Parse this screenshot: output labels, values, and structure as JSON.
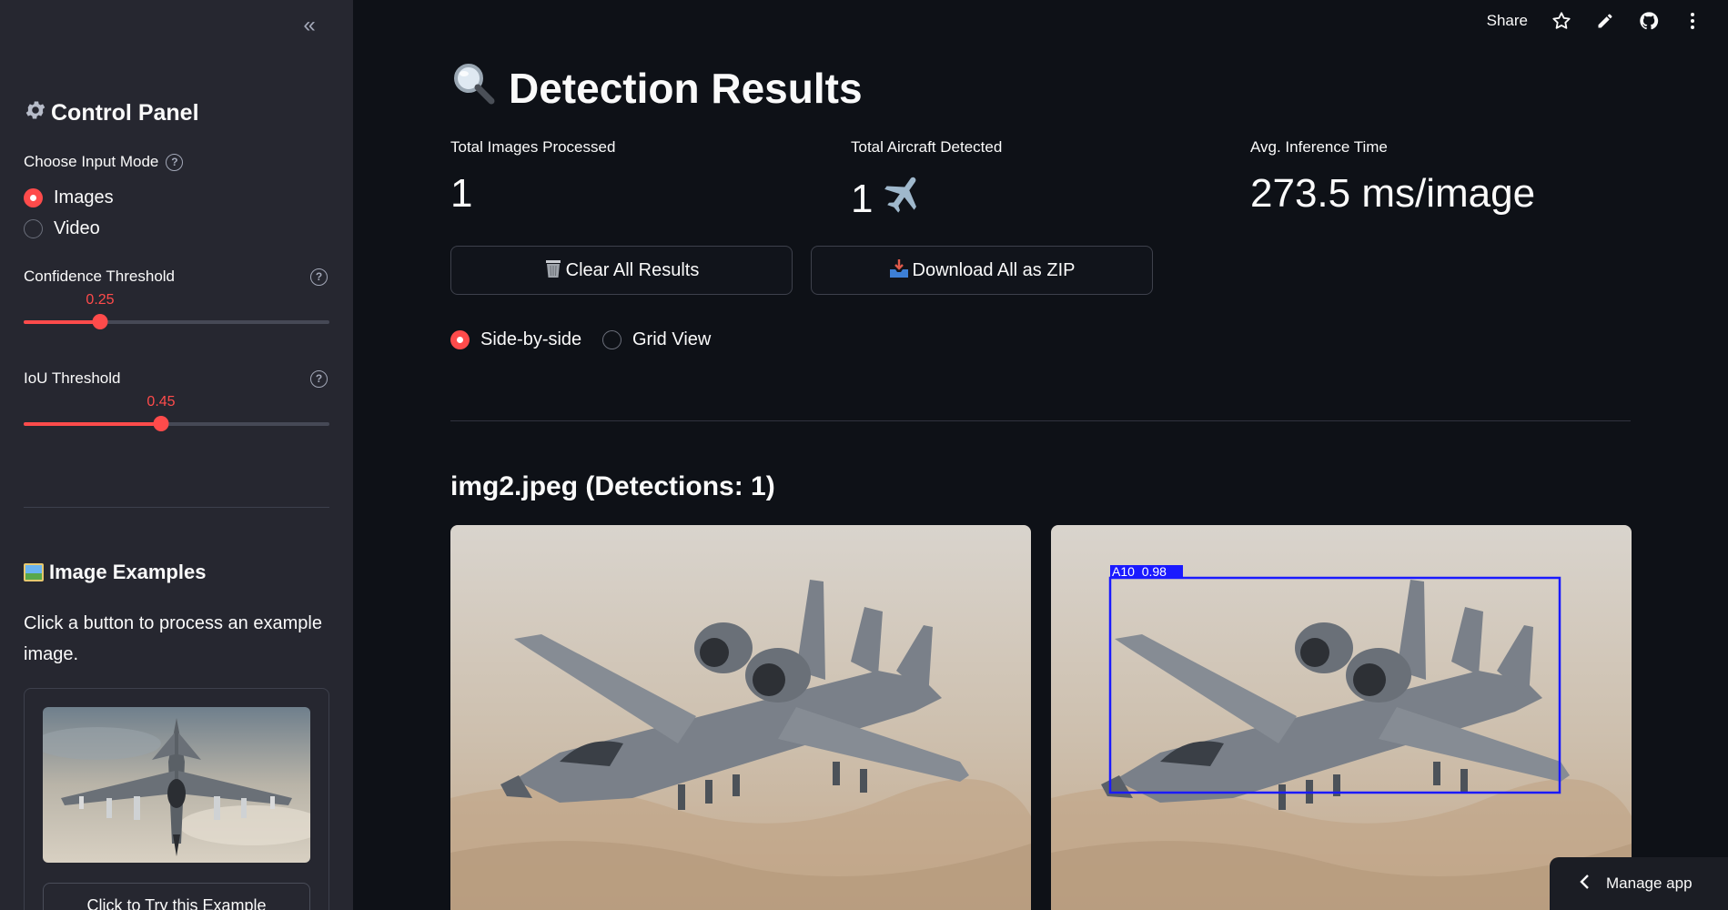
{
  "sidebar": {
    "collapse_glyph": "«",
    "title": "Control Panel",
    "title_icon": "gear-icon",
    "input_mode": {
      "label": "Choose Input Mode",
      "options": [
        "Images",
        "Video"
      ],
      "selected": "Images"
    },
    "confidence": {
      "label": "Confidence Threshold",
      "value_text": "0.25",
      "value": 0.25,
      "min": 0,
      "max": 1
    },
    "iou": {
      "label": "IoU Threshold",
      "value_text": "0.45",
      "value": 0.45,
      "min": 0,
      "max": 1
    },
    "examples": {
      "title": "Image Examples",
      "title_icon": "picture-icon",
      "description": "Click a button to process an example image.",
      "button_label": "Click to Try this Example"
    }
  },
  "toolbar": {
    "share_label": "Share",
    "icons": [
      "star-icon",
      "pencil-icon",
      "github-icon",
      "more-vertical-icon"
    ]
  },
  "main": {
    "title": "Detection Results",
    "title_icon": "magnifier-icon",
    "metrics": [
      {
        "label": "Total Images Processed",
        "value": "1"
      },
      {
        "label": "Total Aircraft Detected",
        "value": "1",
        "icon": "airplane-icon"
      },
      {
        "label": "Avg. Inference Time",
        "value": "273.5 ms/image"
      }
    ],
    "buttons": {
      "clear": {
        "label": "Clear All Results",
        "icon": "wastebasket-icon"
      },
      "download": {
        "label": "Download All as ZIP",
        "icon": "inbox-tray-icon"
      }
    },
    "view_mode": {
      "options": [
        "Side-by-side",
        "Grid View"
      ],
      "selected": "Side-by-side"
    },
    "result": {
      "heading": "img2.jpeg (Detections: 1)",
      "detection_label": "A10  0.98",
      "detection_class": "A10",
      "detection_confidence": 0.98
    }
  },
  "footer": {
    "manage_app_label": "Manage app"
  },
  "colors": {
    "accent": "#ff4b4b",
    "background": "#0e1117",
    "sidebar": "#262730",
    "bbox": "#1a1aff"
  }
}
